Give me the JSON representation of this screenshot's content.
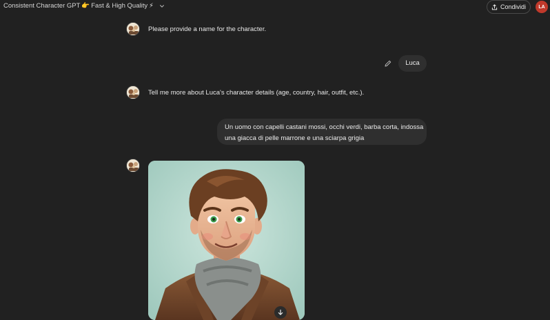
{
  "header": {
    "gpt_name": "Consistent Character GPT",
    "point_emoji": "👉",
    "tagline": "Fast & High Quality",
    "bolt_emoji": "⚡",
    "share_label": "Condividi",
    "user_initials": "LA"
  },
  "conversation": {
    "msg1": "Please provide a name for the character.",
    "reply1": "Luca",
    "msg2": "Tell me more about Luca's character details (age, country, hair, outfit, etc.).",
    "reply2_line1": "Un uomo con capelli castani mossi, occhi verdi, barba corta, indossa",
    "reply2_line2": "una giacca di pelle marrone e una sciarpa grigia"
  },
  "colors": {
    "background": "#212121",
    "user_bubble": "#2f2f2f",
    "user_avatar": "#c0392b"
  }
}
